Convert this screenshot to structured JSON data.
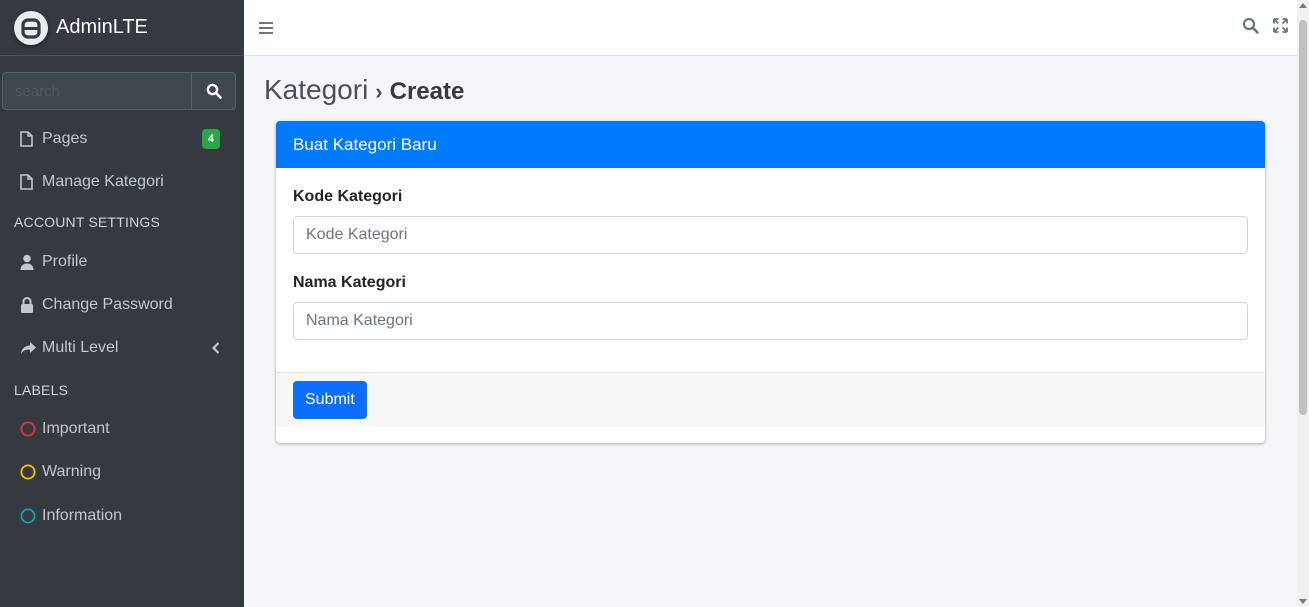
{
  "brand": {
    "name_bold": "Admin",
    "name_light": "LTE"
  },
  "sidebar": {
    "search_placeholder": "search",
    "items": [
      {
        "label": "Pages",
        "icon": "file-icon",
        "badge": "4"
      },
      {
        "label": "Manage Kategori",
        "icon": "file-icon"
      }
    ],
    "account_header": "ACCOUNT SETTINGS",
    "account_items": [
      {
        "label": "Profile",
        "icon": "user-icon"
      },
      {
        "label": "Change Password",
        "icon": "lock-icon"
      },
      {
        "label": "Multi Level",
        "icon": "share-icon"
      }
    ],
    "labels_header": "LABELS",
    "labels": [
      {
        "label": "Important",
        "color": "#dc3545"
      },
      {
        "label": "Warning",
        "color": "#ffc107"
      },
      {
        "label": "Information",
        "color": "#17a2b8"
      }
    ]
  },
  "page": {
    "title": "Kategori",
    "separator": "›",
    "subtitle": "Create"
  },
  "card": {
    "header": "Buat Kategori Baru",
    "fields": [
      {
        "label": "Kode Kategori",
        "placeholder": "Kode Kategori"
      },
      {
        "label": "Nama Kategori",
        "placeholder": "Nama Kategori"
      }
    ],
    "submit_label": "Submit"
  },
  "colors": {
    "primary": "#007bff",
    "sidebar_bg": "#343a40",
    "badge_success": "#28a745",
    "button": "#0d6efd"
  }
}
